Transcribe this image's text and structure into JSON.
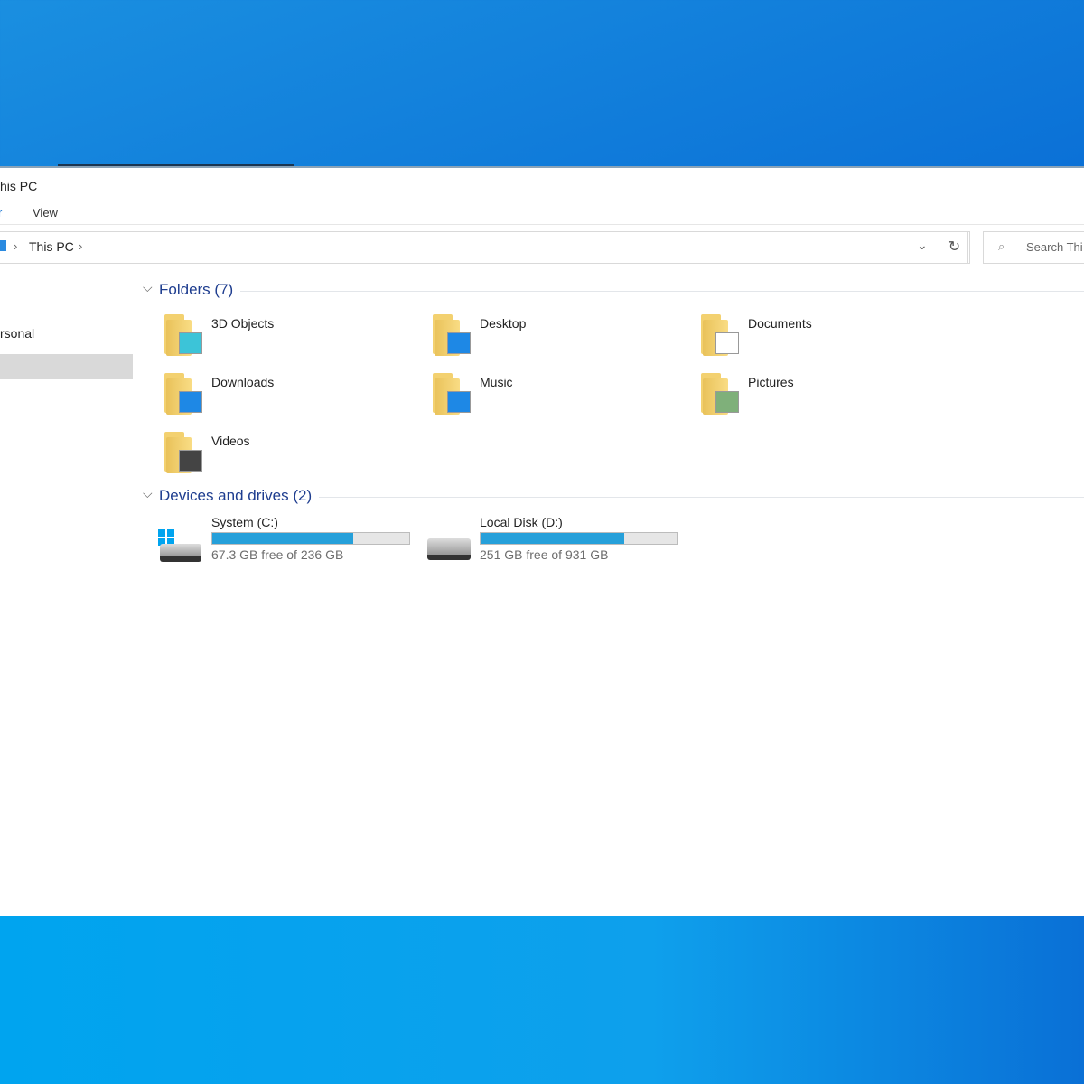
{
  "window": {
    "title": "his PC",
    "ribbon_tabs": [
      "r",
      "View"
    ]
  },
  "address": {
    "path": [
      "This PC"
    ],
    "search_placeholder": "Search Thi"
  },
  "nav": {
    "items": [
      "rsonal"
    ]
  },
  "folders": {
    "header": "Folders (7)",
    "items": [
      {
        "label": "3D Objects",
        "icon": "3d-objects-folder-icon"
      },
      {
        "label": "Desktop",
        "icon": "desktop-folder-icon"
      },
      {
        "label": "Documents",
        "icon": "documents-folder-icon"
      },
      {
        "label": "Downloads",
        "icon": "downloads-folder-icon"
      },
      {
        "label": "Music",
        "icon": "music-folder-icon"
      },
      {
        "label": "Pictures",
        "icon": "pictures-folder-icon"
      },
      {
        "label": "Videos",
        "icon": "videos-folder-icon"
      }
    ]
  },
  "drives": {
    "header": "Devices and drives (2)",
    "items": [
      {
        "label": "System (C:)",
        "free_text": "67.3 GB free of 236 GB",
        "used_fraction": 0.715,
        "icon": "windows-drive-icon"
      },
      {
        "label": "Local Disk (D:)",
        "free_text": "251 GB free of 931 GB",
        "used_fraction": 0.73,
        "icon": "hard-drive-icon"
      }
    ]
  },
  "colors": {
    "accent": "#26a0da",
    "group_header": "#1e3d8f",
    "desktop": "#0a6fd6"
  }
}
